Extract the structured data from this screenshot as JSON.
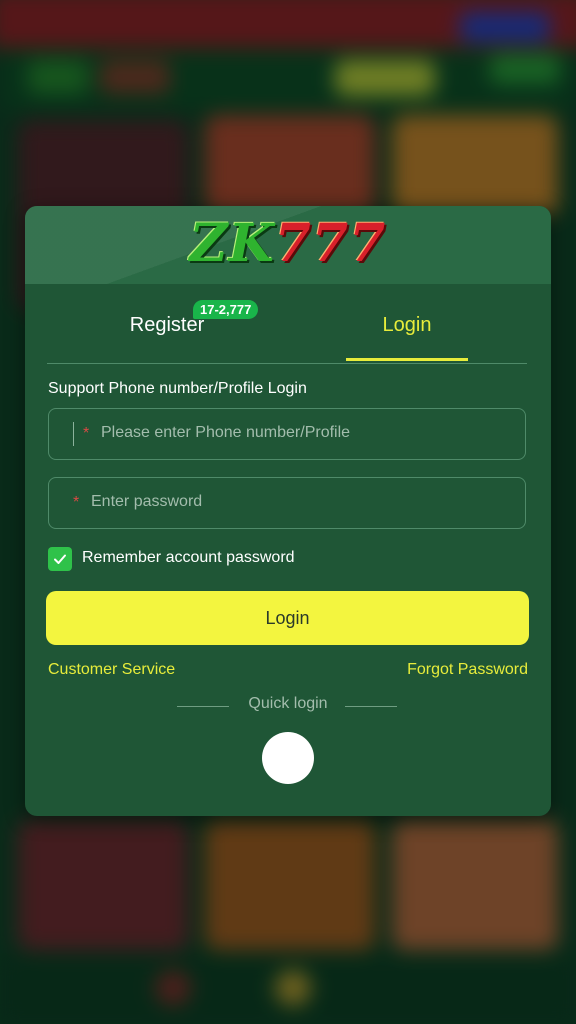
{
  "logo": {
    "part1": "ZK",
    "part2": "777"
  },
  "tabs": {
    "register_label": "Register",
    "register_badge": "17-2,777",
    "login_label": "Login",
    "active": "Login"
  },
  "form": {
    "section_label": "Support Phone number/Profile Login",
    "phone": {
      "required_mark": "*",
      "placeholder": "Please enter Phone number/Profile",
      "value": ""
    },
    "password": {
      "required_mark": "*",
      "placeholder": "Enter password",
      "value": ""
    },
    "remember": {
      "label": "Remember account password",
      "checked": true
    },
    "submit_label": "Login"
  },
  "links": {
    "customer_service": "Customer Service",
    "forgot_password": "Forgot Password"
  },
  "quick_login": {
    "label": "Quick login"
  },
  "colors": {
    "accent": "#e7ec3b",
    "button": "#f3f53f",
    "modal_bg": "#1f5636",
    "check": "#2fc24a",
    "badge": "#19b54a",
    "required": "#d84a44"
  }
}
